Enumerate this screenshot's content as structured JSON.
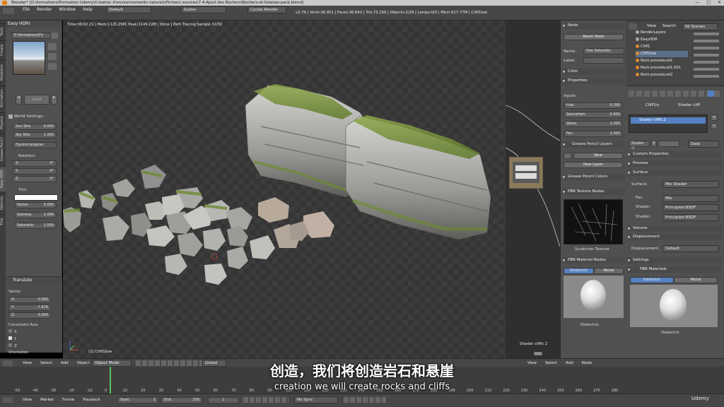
{
  "window": {
    "title": "Blender* [D:\\formations\\Formation Udemy\\Création d'environnements naturels\\Fichiers sources\\7.4-Ajout des Rochers\\Rochers-et-falaises-pack.blend]",
    "controls": [
      "—",
      "□",
      "✕"
    ]
  },
  "info_bar": {
    "menus": [
      "File",
      "Render",
      "Window",
      "Help"
    ],
    "layout": "Default",
    "scene": "Scene",
    "engine": "Cycles Render",
    "stats": "v2.79 | Verts:36,951 | Faces:36,642 | Tris:73,150 | Objects:2/29 | Lamps:0/0 | Mem:917.77M | Cliff1low"
  },
  "tool_tabs": [
    "Tools",
    "Create",
    "Relations",
    "Animation",
    "Physics",
    "Grease Pencil",
    "Easy HDRI",
    "Options",
    "Title"
  ],
  "easy_hdri": {
    "header": "Easy HDRI",
    "path": "E:\\formations\\Fo",
    "load_label": "Load",
    "world_settings": "World Settings:",
    "sun_strength": {
      "label": "Sun Stre",
      "value": "0.000"
    },
    "sky_strength": {
      "label": "Sky Stre",
      "value": "1.500"
    },
    "projection": "Equirectangular",
    "rotation_label": "Rotation:",
    "rot_x": {
      "label": "X:",
      "value": "0°"
    },
    "rot_y": {
      "label": "Y:",
      "value": "0°"
    },
    "rot_z": {
      "label": "Z:",
      "value": "0°"
    },
    "tint_label": "Tint:",
    "factor": {
      "label": "Factor:",
      "value": "0.000"
    },
    "gamma": {
      "label": "Gamma:",
      "value": "1.000"
    },
    "saturation": {
      "label": "Saturatio:",
      "value": "1.000"
    }
  },
  "translate_panel": {
    "header": "Translate",
    "vector_label": "Vector",
    "x": {
      "label": "X:",
      "value": "0.000"
    },
    "y": {
      "label": "Y:",
      "value": "-7.676"
    },
    "z": {
      "label": "Z:",
      "value": "0.000"
    },
    "constraint_label": "Constraint Axis",
    "axes": [
      "X",
      "Y",
      "Z"
    ],
    "orientation_label": "Orientation"
  },
  "viewport": {
    "info": "Time:00:02.21 | Mem:1125.29M, Peak:1149.22M | Done | Path Tracing Sample 32/32",
    "object_label": "(1) Cliff1low"
  },
  "node_panel": {
    "header": "Node",
    "reset_label": "Reset Node",
    "name_label": "Name:",
    "name_value": "Hue Saturatio.",
    "label_label": "Label:",
    "color_label": "Color",
    "properties_label": "Properties",
    "inputs_label": "Inputs:",
    "hue": {
      "label": "Hue:",
      "value": "0.300"
    },
    "saturation": {
      "label": "Saturation:",
      "value": "0.400"
    },
    "value": {
      "label": "Value:",
      "value": "1.000"
    },
    "fac": {
      "label": "Fac:",
      "value": "1.000"
    },
    "grease_layers": "Grease Pencil Layers",
    "new_label": "New",
    "new_layer_label": "New Layer",
    "grease_colors": "Grease Pencil Colors",
    "pbr_texture": "PBR Texture Nodes",
    "scratches": "Scratches Texture",
    "pbr_material": "PBR Material Nodes",
    "tab_dielectric": "Dielectric",
    "tab_metal": "Metal",
    "dielectric_label": "Dielectric",
    "node_title": "Shader cliffs 2"
  },
  "outliner": {
    "tabs": [
      "View",
      "Search",
      "All Scenes"
    ],
    "items": [
      "RenderLayers",
      "EasyHDR",
      "Cliff1",
      "Cliff1low",
      "Rock-procedural1",
      "Rock-procedural1.001",
      "Rock-procedural2"
    ]
  },
  "properties": {
    "object": "Cliff1lo",
    "material": "Shader cliff",
    "slot": "Shader cliffs.2",
    "mat_field": "Shader cl",
    "mat_flag": "F",
    "data_label": "Data",
    "sections": [
      "Custom Properties",
      "Preview",
      "Surface"
    ],
    "surface": {
      "label": "Surface:",
      "value": "Mix Shader"
    },
    "fac": {
      "label": "Fac:",
      "value": "Mix"
    },
    "shader1": {
      "label": "Shader:",
      "value": "Principled BSDF"
    },
    "shader2": {
      "label": "Shader:",
      "value": "Principled BSDF"
    },
    "volume": "Volume",
    "displacement": "Displacement",
    "disp_field": {
      "label": "Displacement:",
      "value": "Default"
    },
    "settings": "Settings",
    "pbr_materials": "PBR Materials",
    "tab_dielectric": "Dielectric",
    "tab_metal": "Metal",
    "dielectric_label": "Dielectric"
  },
  "bottom_bar": {
    "view_menus": [
      "View",
      "Select",
      "Add",
      "Object"
    ],
    "mode": "Object Mode",
    "orientation": "Global",
    "node_menus": [
      "View",
      "Select",
      "Add",
      "Node"
    ]
  },
  "timeline": {
    "ticks": [
      "-50",
      "-40",
      "-30",
      "-20",
      "-10",
      "0",
      "10",
      "20",
      "30",
      "40",
      "50",
      "60",
      "70",
      "80",
      "90",
      "100",
      "110",
      "120",
      "130",
      "140",
      "150",
      "160",
      "170",
      "180",
      "190",
      "200",
      "210",
      "220",
      "230",
      "240",
      "250",
      "260",
      "270",
      "280"
    ],
    "menus": [
      "View",
      "Marker",
      "Frame",
      "Playback"
    ],
    "start": {
      "label": "Start:",
      "value": "1"
    },
    "end": {
      "label": "End:",
      "value": "250"
    },
    "current": "1",
    "sync": "No Sync"
  },
  "subtitles": {
    "cn": "创造，我们将创造岩石和悬崖",
    "en": "creation we will create rocks and cliffs"
  },
  "brand": "Udemy"
}
